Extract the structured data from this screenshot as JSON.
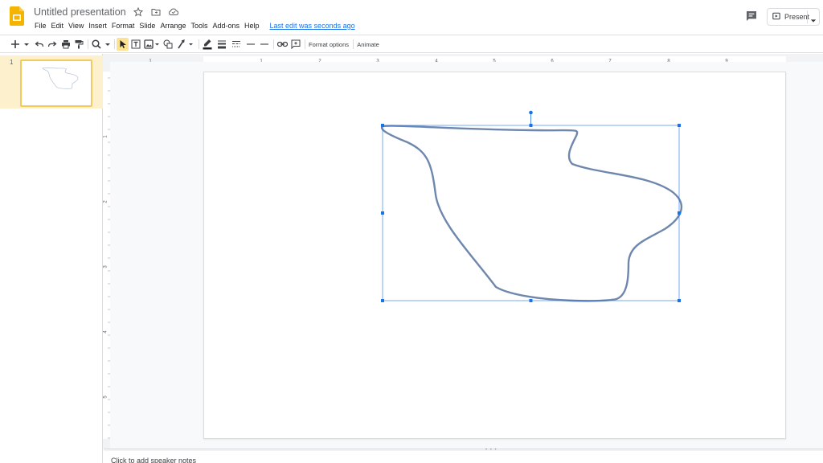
{
  "app": {
    "title": "Untitled presentation",
    "icon": "google-slides-logo",
    "accent_color": "#f4b400"
  },
  "menu": {
    "items": [
      "File",
      "Edit",
      "View",
      "Insert",
      "Format",
      "Slide",
      "Arrange",
      "Tools",
      "Add-ons",
      "Help"
    ],
    "last_edit": "Last edit was seconds ago"
  },
  "header": {
    "present_label": "Present"
  },
  "toolbar": {
    "format_options": "Format options",
    "animate": "Animate",
    "icons": [
      "new-slide-icon",
      "undo-icon",
      "redo-icon",
      "print-icon",
      "paint-format-icon",
      "zoom-icon",
      "select-icon",
      "text-box-icon",
      "image-icon",
      "shape-icon",
      "line-icon",
      "border-color-icon",
      "border-weight-icon",
      "border-dash-icon",
      "line-start-icon",
      "line-end-icon",
      "link-icon",
      "comment-icon"
    ]
  },
  "filmstrip": {
    "slides": [
      {
        "number": "1"
      }
    ]
  },
  "rulers": {
    "top_ticks": [
      "1",
      "1",
      "2",
      "3",
      "4",
      "5",
      "6",
      "7",
      "8",
      "9"
    ],
    "left_ticks": [
      "1",
      "2",
      "3",
      "4",
      "5"
    ]
  },
  "slide": {
    "shape_stroke_color": "#6f87ad",
    "selection_color": "#1a73e8"
  },
  "notes": {
    "placeholder": "Click to add speaker notes"
  }
}
